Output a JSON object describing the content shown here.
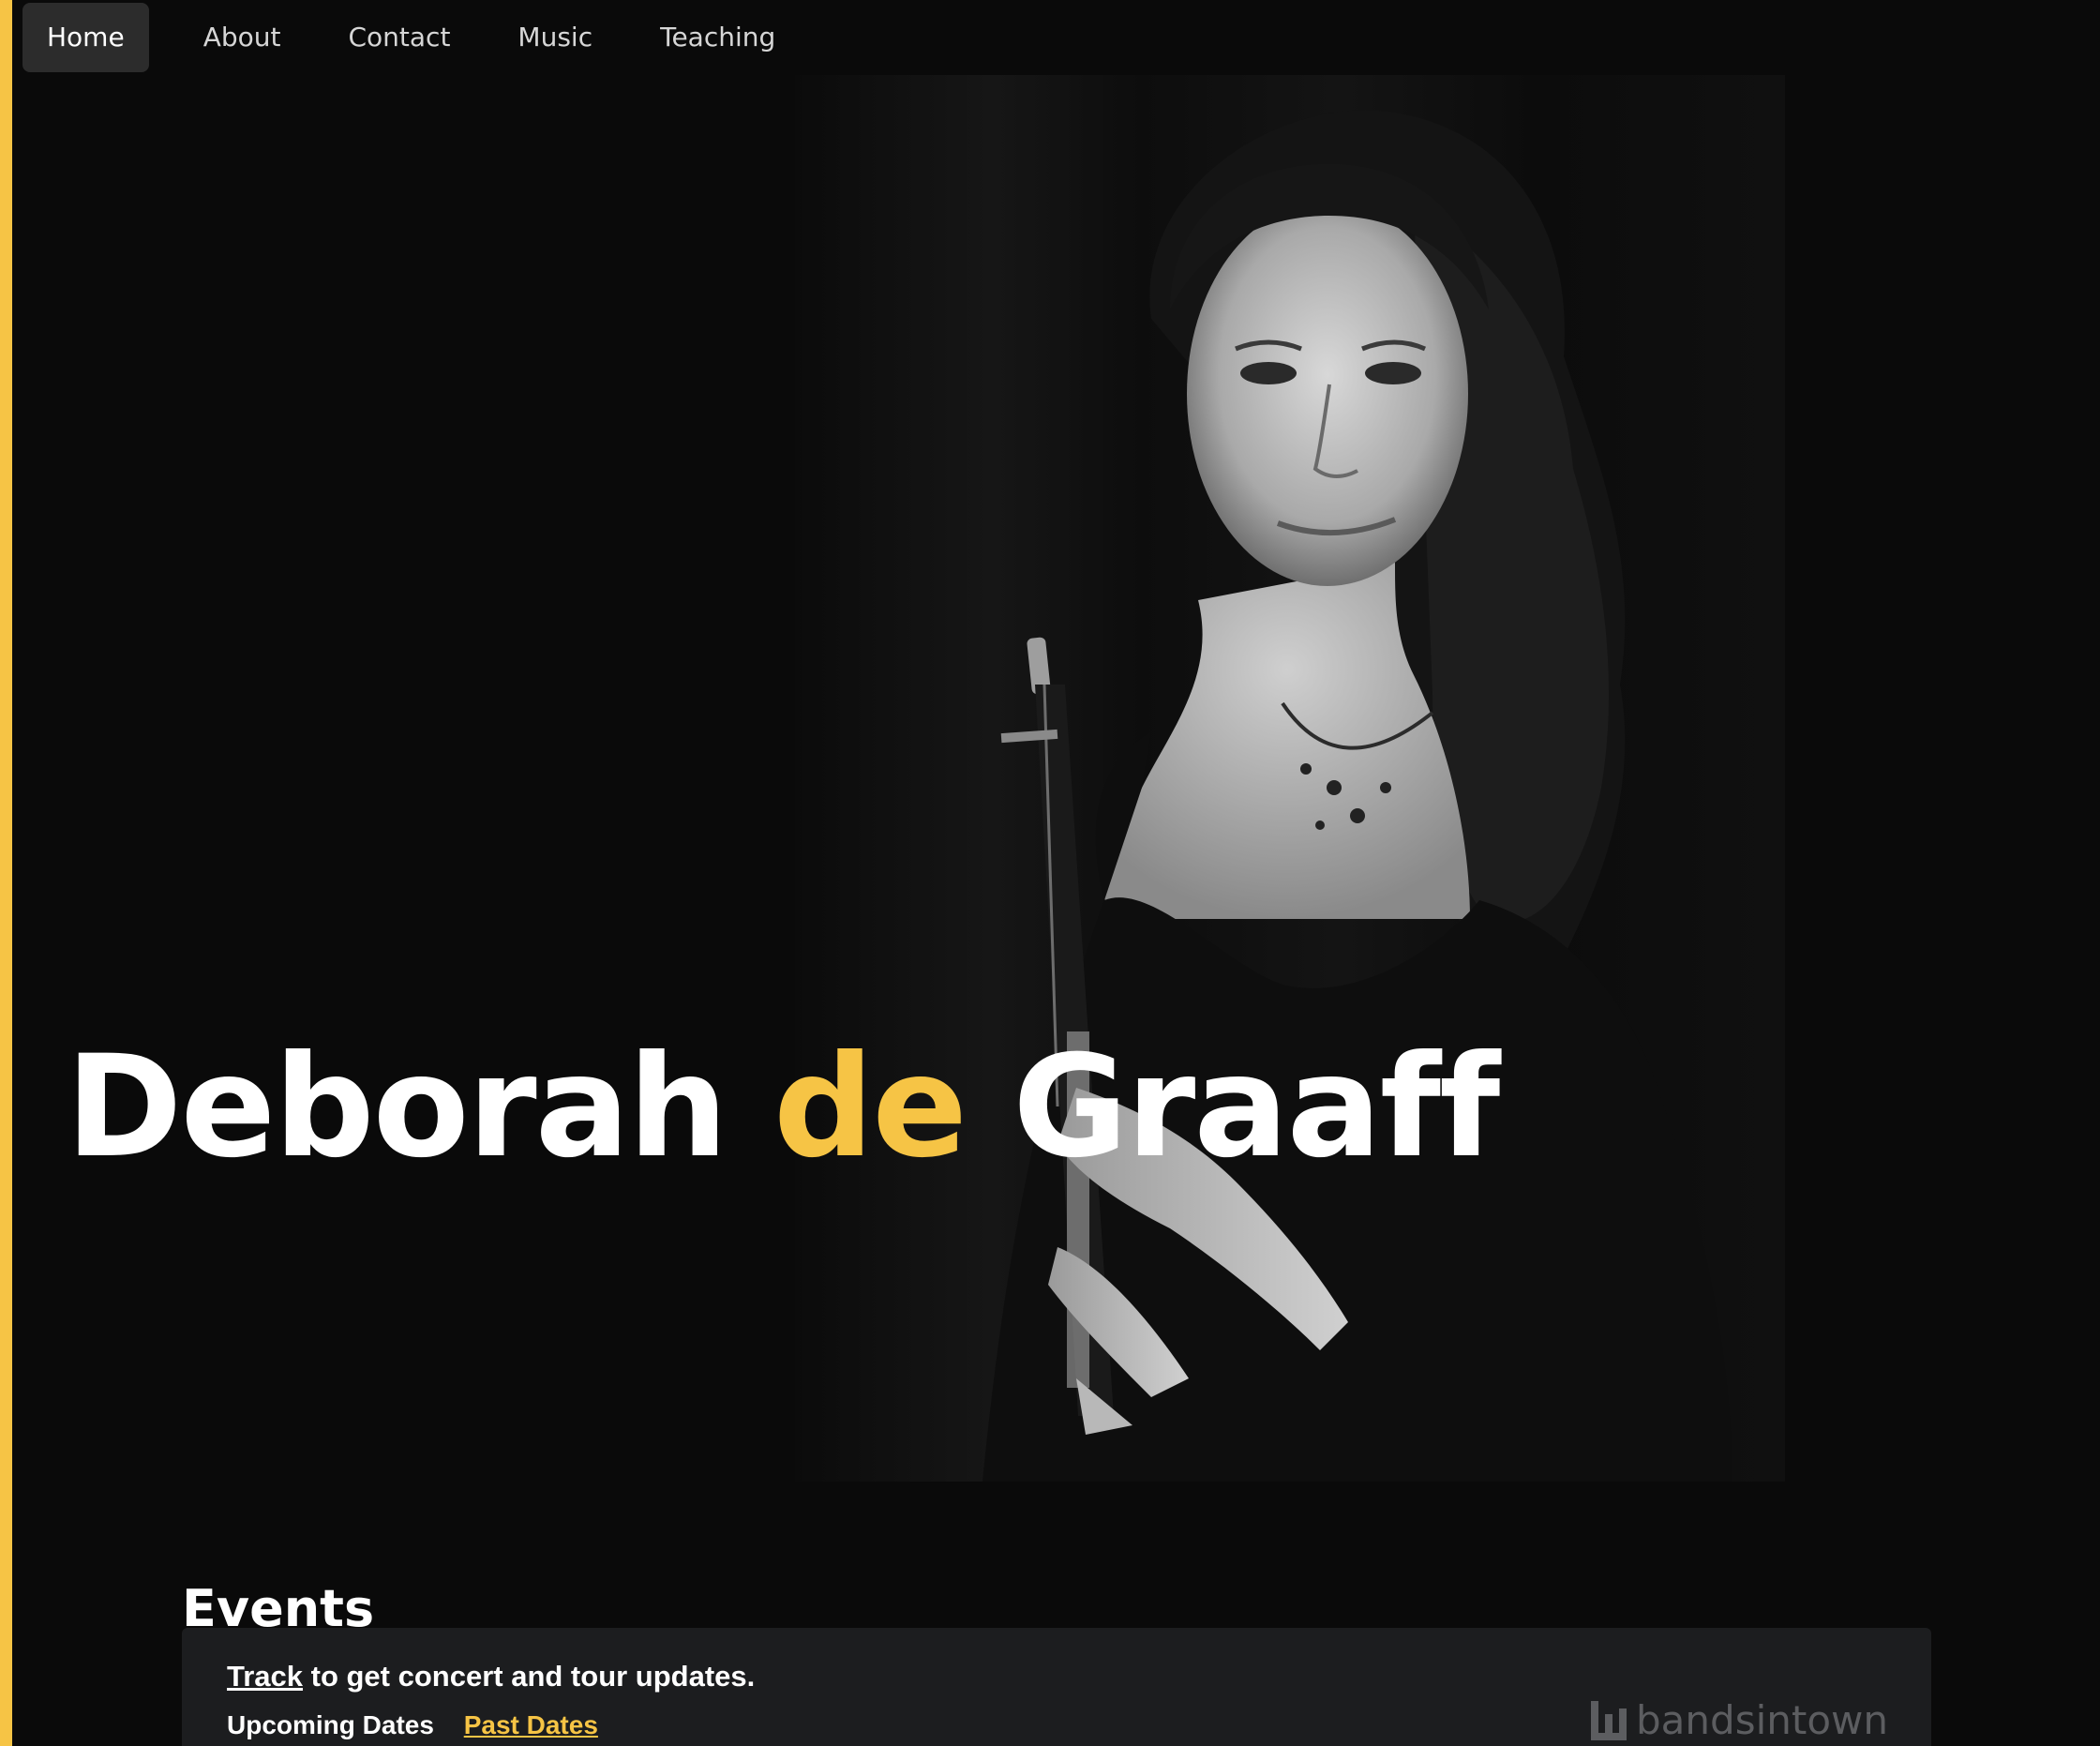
{
  "nav": {
    "items": [
      {
        "label": "Home",
        "active": true
      },
      {
        "label": "About",
        "active": false
      },
      {
        "label": "Contact",
        "active": false
      },
      {
        "label": "Music",
        "active": false
      },
      {
        "label": "Teaching",
        "active": false
      }
    ]
  },
  "hero": {
    "name_first": "Deborah",
    "name_particle": "de",
    "name_last": "Graaff",
    "photo_icon": "portrait-photo"
  },
  "events": {
    "heading": "Events",
    "track_link": "Track",
    "track_text": " to get concert and tour updates.",
    "upcoming_label": "Upcoming Dates",
    "past_label": "Past Dates",
    "brand": "bandsintown",
    "brand_icon": "bandsintown-logo-icon"
  },
  "colors": {
    "accent": "#f6c445",
    "background": "#0a0a0a",
    "card": "#1c1d1f"
  }
}
